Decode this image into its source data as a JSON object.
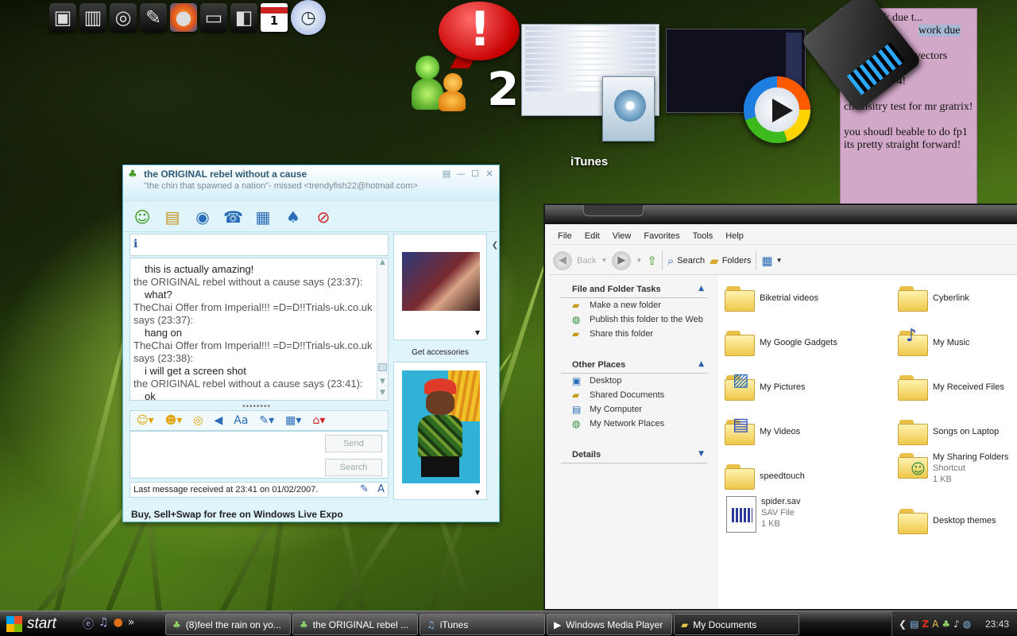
{
  "desktop": {
    "background": "green grass wallpaper"
  },
  "dock": {
    "icons": [
      "computer-icon",
      "server-icon",
      "dvd-icon",
      "pen-icon",
      "firefox-icon",
      "laptop-icon",
      "cube-icon",
      "calendar-icon",
      "clock-icon"
    ],
    "calendar_day": "1"
  },
  "overlay": {
    "msn_count": "2",
    "itunes_label": "iTunes"
  },
  "note": {
    "lines": [
      "Fu... work due t...",
      "work due",
      "...cias vectors",
      "what else... 4!",
      "chemsitry test for mr gratrix!",
      "you shoudl beable to do fp1 its pretty straight forward!"
    ]
  },
  "msn": {
    "title": "the ORIGINAL rebel without a cause",
    "subtitle": "\"the chin that spawned a nation\"- missed <trendyfish22@hotmail.com>",
    "conversation": [
      {
        "who": "",
        "msg": "this is actually amazing!"
      },
      {
        "who": "the ORIGINAL rebel without a cause says (23:37):",
        "msg": "what?"
      },
      {
        "who": "TheChai Offer from Imperial!!! =D=D!!Trials-uk.co.uk says (23:37):",
        "msg": "hang on"
      },
      {
        "who": "TheChai Offer from Imperial!!! =D=D!!Trials-uk.co.uk says (23:38):",
        "msg": "i will get a screen shot"
      },
      {
        "who": "the ORIGINAL rebel without a cause says (23:41):",
        "msg": "ok"
      }
    ],
    "send_label": "Send",
    "search_label": "Search",
    "status": "Last message received at 23:41 on 01/02/2007.",
    "get_accessories": "Get accessories",
    "expo": "Buy, Sell+Swap for free on Windows Live Expo"
  },
  "explorer": {
    "menu": [
      "File",
      "Edit",
      "View",
      "Favorites",
      "Tools",
      "Help"
    ],
    "toolbar": {
      "back": "Back",
      "search": "Search",
      "folders": "Folders"
    },
    "tasks": {
      "title": "File and Folder Tasks",
      "items": [
        "Make a new folder",
        "Publish this folder to the Web",
        "Share this folder"
      ]
    },
    "other": {
      "title": "Other Places",
      "items": [
        "Desktop",
        "Shared Documents",
        "My Computer",
        "My Network Places"
      ]
    },
    "details": {
      "title": "Details"
    },
    "files": [
      {
        "name": "Biketrial videos"
      },
      {
        "name": "Cyberlink"
      },
      {
        "name": "My Google Gadgets"
      },
      {
        "name": "My Music"
      },
      {
        "name": "My Pictures"
      },
      {
        "name": "My Received Files"
      },
      {
        "name": "My Videos"
      },
      {
        "name": "Songs on Laptop"
      },
      {
        "name": "speedtouch"
      },
      {
        "name": "My Sharing Folders",
        "type": "Shortcut",
        "size": "1 KB"
      },
      {
        "name": "spider.sav",
        "type": "SAV File",
        "size": "1 KB"
      },
      {
        "name": "Desktop themes"
      }
    ]
  },
  "taskbar": {
    "start": "start",
    "buttons": [
      "(8)feel the rain on yo...",
      "the ORIGINAL rebel ...",
      "iTunes",
      "Windows Media Player",
      "My Documents"
    ],
    "time": "23:43"
  }
}
